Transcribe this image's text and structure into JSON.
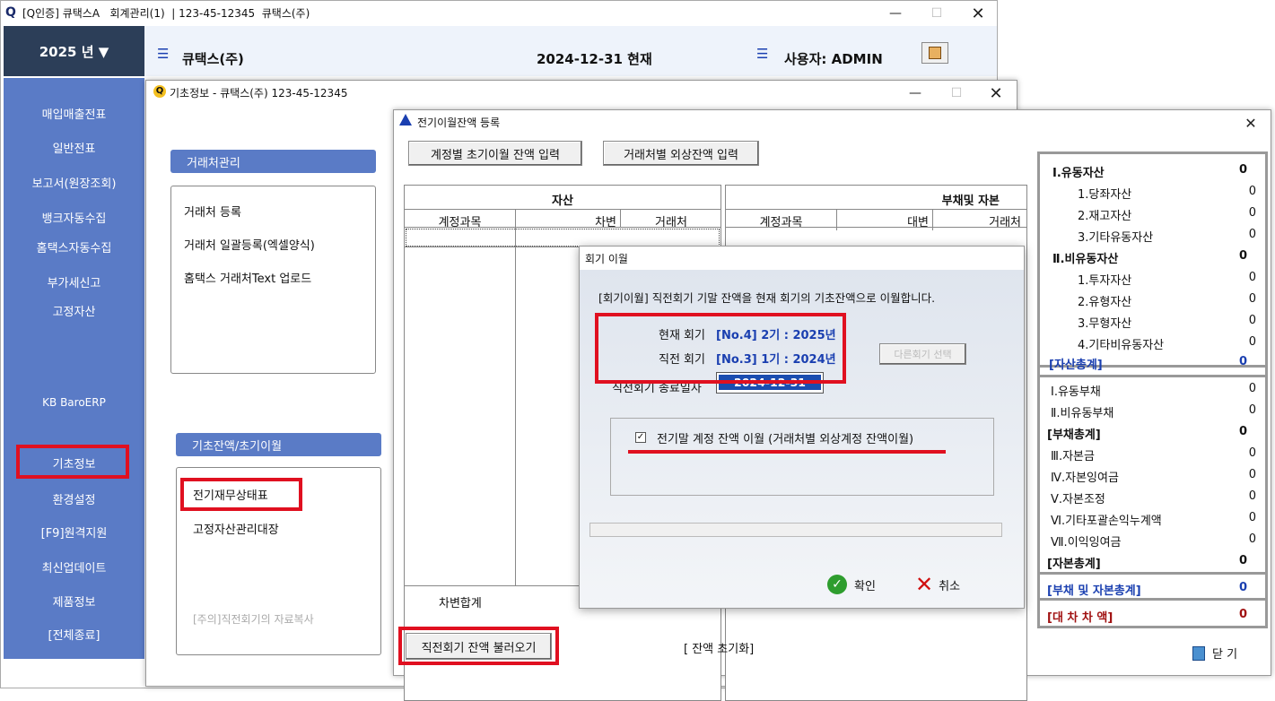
{
  "main_window": {
    "title": "[Q인증] 큐택스A   회계관리(1)  | 123-45-12345  큐택스(주)",
    "year_label": "2025 년 ▼",
    "company": "큐택스(주)",
    "date_now": "2024-12-31 현재",
    "user": "사용자: ADMIN"
  },
  "sidebar": {
    "items": [
      {
        "label": "매입매출전표"
      },
      {
        "label": "일반전표"
      },
      {
        "label": "보고서(원장조회)"
      },
      {
        "label": "뱅크자동수집"
      },
      {
        "label": "홈택스자동수집"
      },
      {
        "label": "부가세신고"
      },
      {
        "label": "고정자산"
      },
      {
        "label": "KB BaroERP"
      },
      {
        "label": "기초정보"
      },
      {
        "label": "환경설정"
      },
      {
        "label": "[F9]원격지원"
      },
      {
        "label": "최신업데이트"
      },
      {
        "label": "제품정보"
      },
      {
        "label": "[전체종료]"
      }
    ]
  },
  "basic_window": {
    "title": "기초정보 - 큐택스(주) 123-45-12345",
    "section1": {
      "title": "거래처관리",
      "items": [
        "거래처 등록",
        "거래처 일괄등록(엑셀양식)",
        "홈택스 거래처Text 업로드"
      ]
    },
    "section2": {
      "title": "기초잔액/초기이월",
      "items": [
        "전기재무상태표",
        "고정자산관리대장"
      ],
      "note": "[주의]직전회기의 자료복사"
    }
  },
  "balance_window": {
    "title": "전기이월잔액 등록",
    "btn_account": "계정별 초기이월 잔액 입력",
    "btn_vendor": "거래처별 외상잔액 입력",
    "assets_header": "자산",
    "liab_header": "부채및 자본",
    "col_account": "계정과목",
    "col_debit": "차변",
    "col_credit": "대변",
    "col_vendor": "거래처",
    "debit_total": "차변합계",
    "btn_load_prev": "직전회기 잔액 불러오기",
    "btn_reset": "[ 잔액 초기화]",
    "btn_close": "닫 기",
    "summary": {
      "assets": [
        {
          "label": "Ⅰ.유동자산",
          "value": "0",
          "bold": true
        },
        {
          "label": "1.당좌자산",
          "value": "0"
        },
        {
          "label": "2.재고자산",
          "value": "0"
        },
        {
          "label": "3.기타유동자산",
          "value": "0"
        },
        {
          "label": "Ⅱ.비유동자산",
          "value": "0",
          "bold": true
        },
        {
          "label": "1.투자자산",
          "value": "0"
        },
        {
          "label": "2.유형자산",
          "value": "0"
        },
        {
          "label": "3.무형자산",
          "value": "0"
        },
        {
          "label": "4.기타비유동자산",
          "value": "0"
        }
      ],
      "assets_total": {
        "label": "[자산총계]",
        "value": "0"
      },
      "liab": [
        {
          "label": "Ⅰ.유동부채",
          "value": "0"
        },
        {
          "label": "Ⅱ.비유동부채",
          "value": "0"
        }
      ],
      "liab_total": {
        "label": "[부채총계]",
        "value": "0"
      },
      "equity": [
        {
          "label": "Ⅲ.자본금",
          "value": "0"
        },
        {
          "label": "Ⅳ.자본잉여금",
          "value": "0"
        },
        {
          "label": "Ⅴ.자본조정",
          "value": "0"
        },
        {
          "label": "Ⅵ.기타포괄손익누계액",
          "value": "0"
        },
        {
          "label": "Ⅶ.이익잉여금",
          "value": "0"
        }
      ],
      "equity_total": {
        "label": "[자본총계]",
        "value": "0"
      },
      "liab_equity_total": {
        "label": "[부채 및 자본총계]",
        "value": "0"
      },
      "diff": {
        "label": "[대 차 차 액]",
        "value": "0"
      }
    }
  },
  "dialog": {
    "title": "회기 이월",
    "description": "[회기이월] 직전회기 기말 잔액을 현재 회기의 기초잔액으로 이월합니다.",
    "current_label": "현재 회기",
    "current_value": "[No.4] 2기 : 2025년",
    "prev_label": "직전 회기",
    "prev_value": "[No.3] 1기 : 2024년",
    "end_date_label": "직전회기 종료일자",
    "end_date_value": "2024-12-31",
    "disabled_btn": "다른회기 선택",
    "checkbox_label": "전기말 계정 잔액 이월 (거래처별 외상계정 잔액이월)",
    "ok_label": "확인",
    "cancel_label": "취소"
  },
  "colors": {
    "sidebar_bg": "#5a7bc6",
    "highlight_red": "#e01020",
    "header_blue": "#1a3fb0"
  }
}
